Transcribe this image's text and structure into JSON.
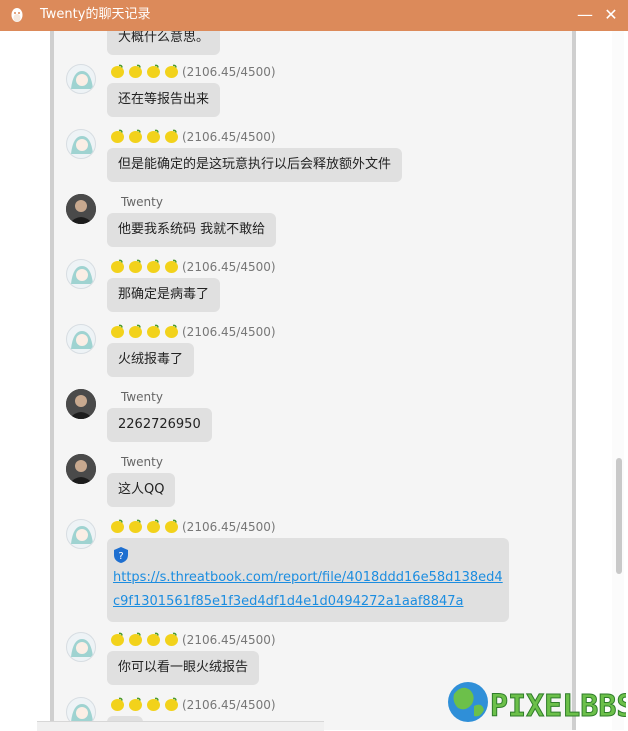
{
  "window": {
    "title": "Twenty的聊天记录",
    "minimize_icon": "minimize-icon",
    "close_icon": "close-icon"
  },
  "colors": {
    "titlebar": "#dc8a5a",
    "bubble": "#e0e0e0",
    "link": "#1c8de0",
    "lemon": "#f2d21b"
  },
  "badge": {
    "score": "(2106.45/4500)"
  },
  "messages": [
    {
      "sender": "other",
      "nick": "",
      "text": "大概什么意思。"
    },
    {
      "sender": "other",
      "nick": "",
      "text": "还在等报告出来"
    },
    {
      "sender": "other",
      "nick": "",
      "text": "但是能确定的是这玩意执行以后会释放额外文件"
    },
    {
      "sender": "twenty",
      "nick": "Twenty",
      "text": "他要我系统码 我就不敢给"
    },
    {
      "sender": "other",
      "nick": "",
      "text": "那确定是病毒了"
    },
    {
      "sender": "other",
      "nick": "",
      "text": "火绒报毒了"
    },
    {
      "sender": "twenty",
      "nick": "Twenty",
      "text": "2262726950"
    },
    {
      "sender": "twenty",
      "nick": "Twenty",
      "text": "这人QQ"
    },
    {
      "sender": "other",
      "nick": "",
      "text": "https://s.threatbook.com/report/file/4018ddd16e58d138ed4c9f1301561f85e1f3ed4df1d4e1d0494272a1aaf8847a"
    },
    {
      "sender": "other",
      "nick": "",
      "text": "你可以看一眼火绒报告"
    },
    {
      "sender": "other",
      "nick": "",
      "text": ""
    }
  ],
  "watermark": {
    "text": "PIXELBBS"
  }
}
